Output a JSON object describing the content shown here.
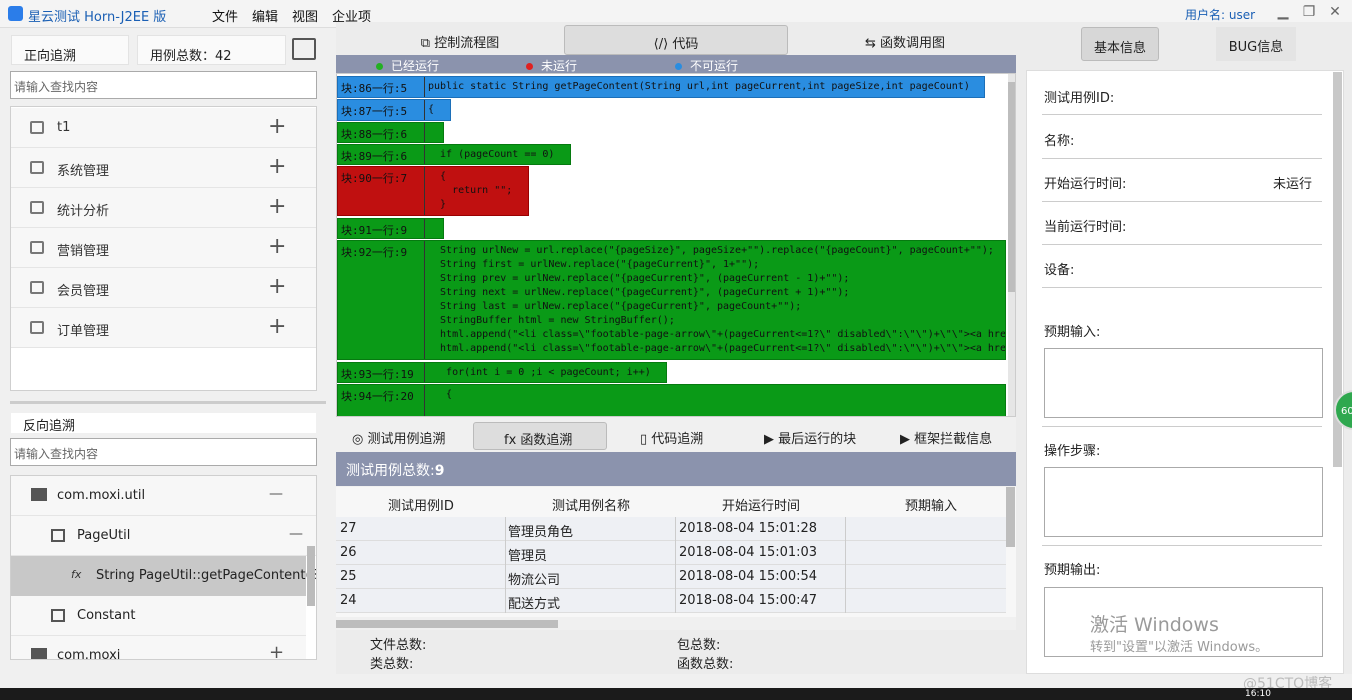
{
  "app": {
    "title": "星云测试 Horn-J2EE 版",
    "user_label": "用户名: user"
  },
  "menu": [
    "文件",
    "编辑",
    "视图",
    "企业项"
  ],
  "left": {
    "forward_trace": "正向追溯",
    "case_total": "用例总数：42",
    "search_placeholder": "请输入查找内容",
    "modules": [
      "t1",
      "系统管理",
      "统计分析",
      "营销管理",
      "会员管理",
      "订单管理"
    ],
    "reverse_trace": "反向追溯",
    "search2_placeholder": "请输入查找内容",
    "tree": [
      {
        "label": "com.moxi.util",
        "sign": "—"
      },
      {
        "label": "PageUtil",
        "sign": "—"
      },
      {
        "label": "String PageUtil::getPageContent(St"
      },
      {
        "label": "Constant"
      },
      {
        "label": "com.moxi",
        "sign": "+"
      }
    ]
  },
  "top_tabs": [
    "控制流程图",
    "代码",
    "函数调用图"
  ],
  "legend": [
    {
      "label": "已经运行",
      "color": "#22b022"
    },
    {
      "label": "未运行",
      "color": "#e02020"
    },
    {
      "label": "不可运行",
      "color": "#2a8de0"
    }
  ],
  "code_blocks": [
    {
      "label": "块:86一行:5",
      "code": "public static String getPageContent(String url,int pageCurrent,int pageSize,int pageCount)"
    },
    {
      "label": "块:87一行:5",
      "code": "{"
    },
    {
      "label": "块:88一行:6",
      "code": ""
    },
    {
      "label": "块:89一行:6",
      "code": "  if (pageCount == 0)"
    },
    {
      "label": "块:90一行:7",
      "code": "  {\n    return \"\";\n  }"
    },
    {
      "label": "块:91一行:9",
      "code": ""
    },
    {
      "label": "块:92一行:9",
      "code": "  String urlNew = url.replace(\"{pageSize}\", pageSize+\"\").replace(\"{pageCount}\", pageCount+\"\");\n  String first = urlNew.replace(\"{pageCurrent}\", 1+\"\");\n  String prev = urlNew.replace(\"{pageCurrent}\", (pageCurrent - 1)+\"\");\n  String next = urlNew.replace(\"{pageCurrent}\", (pageCurrent + 1)+\"\");\n  String last = urlNew.replace(\"{pageCurrent}\", pageCount+\"\");\n  StringBuffer html = new StringBuffer();\n  html.append(\"<li class=\\\"footable-page-arrow\\\"+(pageCurrent<=1?\\\" disabled\\\":\\\"\\\")+\\\"\\\"><a href=\\\"\\\"+\n  html.append(\"<li class=\\\"footable-page-arrow\\\"+(pageCurrent<=1?\\\" disabled\\\":\\\"\\\")+\\\"\\\"><a href=\\\"\\\"+"
    },
    {
      "label": "块:93一行:19",
      "code": "   for(int i = 0 ;i < pageCount; i++)"
    },
    {
      "label": "块:94一行:20",
      "code": "   {"
    }
  ],
  "bottom_tabs": [
    "测试用例追溯",
    "函数追溯",
    "代码追溯",
    "最后运行的块",
    "框架拦截信息"
  ],
  "testcase": {
    "total_label": "测试用例总数:",
    "total": "9",
    "headers": [
      "测试用例ID",
      "测试用例名称",
      "开始运行时间",
      "预期输入"
    ],
    "rows": [
      [
        "27",
        "管理员角色",
        "2018-08-04 15:01:28",
        ""
      ],
      [
        "26",
        "管理员",
        "2018-08-04 15:01:03",
        ""
      ],
      [
        "25",
        "物流公司",
        "2018-08-04 15:00:54",
        ""
      ],
      [
        "24",
        "配送方式",
        "2018-08-04 15:00:47",
        ""
      ]
    ]
  },
  "stats": {
    "files": "文件总数:",
    "packages": "包总数:",
    "classes": "类总数:",
    "functions": "函数总数:"
  },
  "right": {
    "tabs": [
      "基本信息",
      "BUG信息"
    ],
    "fields": [
      "测试用例ID:",
      "名称:",
      "开始运行时间:",
      "当前运行时间:",
      "设备:"
    ],
    "start_value": "未运行",
    "expected_input": "预期输入:",
    "steps": "操作步骤:",
    "expected_output": "预期输出:"
  },
  "watermark": {
    "line1": "激活 Windows",
    "line2": "转到\"设置\"以激活 Windows。",
    "site": "@51CTO博客"
  },
  "badge": "60",
  "clock": "16:10"
}
